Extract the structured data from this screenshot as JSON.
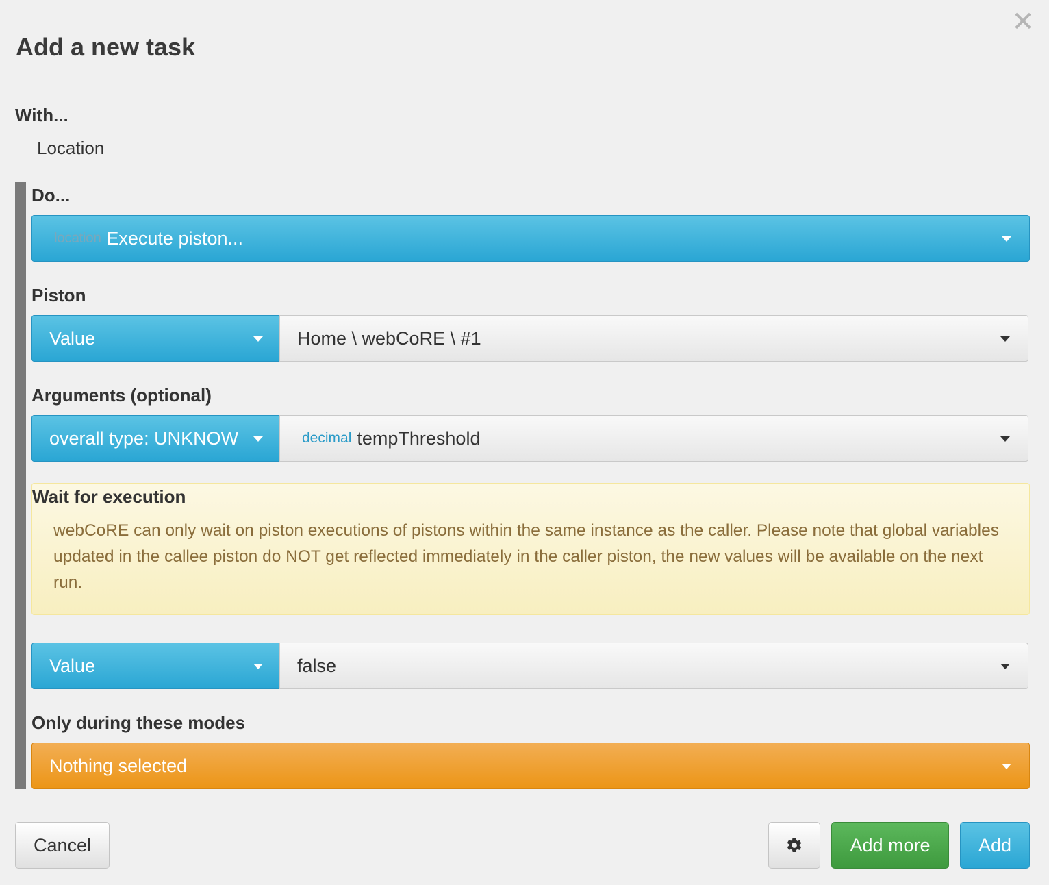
{
  "dialog": {
    "title": "Add a new task",
    "close_glyph": "✕"
  },
  "with_section": {
    "label": "With...",
    "value": "Location"
  },
  "do_section": {
    "label": "Do...",
    "action": {
      "tag": "location",
      "label": "Execute piston..."
    }
  },
  "piston": {
    "label": "Piston",
    "type_select": "Value",
    "value_select": "Home \\ webCoRE \\ #1"
  },
  "arguments": {
    "label": "Arguments (optional)",
    "type_select": "overall type: UNKNOW",
    "value_tag": "decimal",
    "value_select": "tempThreshold"
  },
  "wait": {
    "label": "Wait for execution",
    "notice": "webCoRE can only wait on piston executions of pistons within the same instance as the caller. Please note that global variables updated in the callee piston do NOT get reflected immediately in the caller piston, the new values will be available on the next run.",
    "type_select": "Value",
    "value_select": "false"
  },
  "modes": {
    "label": "Only during these modes",
    "select": "Nothing selected"
  },
  "footer": {
    "cancel": "Cancel",
    "add_more": "Add more",
    "add": "Add"
  },
  "icons": {
    "close": "close-icon",
    "gear": "gear-icon",
    "caret": "caret-down-icon"
  },
  "colors": {
    "primary_blue": "#2aa6d4",
    "warning_orange": "#ec9516",
    "success_green": "#5cb85c",
    "notice_text": "#8a6d3b",
    "notice_bg": "#fcf8e3"
  }
}
